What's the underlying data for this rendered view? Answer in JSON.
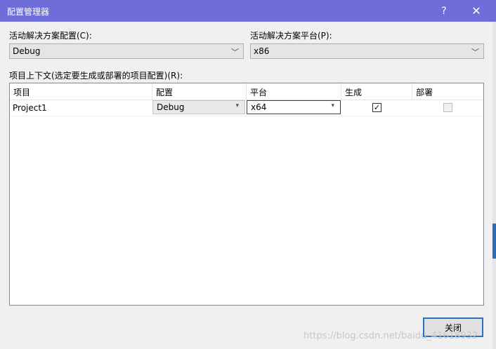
{
  "window": {
    "title": "配置管理器",
    "help_glyph": "?",
    "close_glyph": "✕"
  },
  "active_config": {
    "label": "活动解决方案配置(C):",
    "value": "Debug"
  },
  "active_platform": {
    "label": "活动解决方案平台(P):",
    "value": "x86"
  },
  "project_context": {
    "label": "项目上下文(选定要生成或部署的项目配置)(R):",
    "columns": [
      "项目",
      "配置",
      "平台",
      "生成",
      "部署"
    ],
    "rows": [
      {
        "project": "Project1",
        "configuration": "Debug",
        "platform": "x64",
        "build": true,
        "deploy": false
      }
    ]
  },
  "buttons": {
    "close_label": "关闭"
  },
  "watermark": "https://blog.csdn.net/baidu_41618932",
  "colors": {
    "titlebar": "#6f6dd8",
    "accent": "#2a71c5"
  }
}
